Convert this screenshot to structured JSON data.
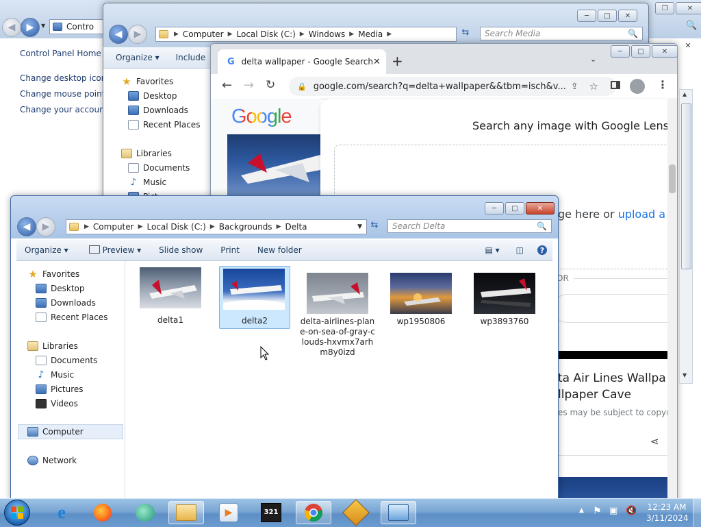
{
  "control_panel": {
    "address": "Contro",
    "home": "Control Panel Home",
    "links": [
      "Change desktop icons",
      "Change mouse pointer",
      "Change your account p"
    ]
  },
  "media_window": {
    "breadcrumb": [
      "Computer",
      "Local Disk (C:)",
      "Windows",
      "Media"
    ],
    "search_placeholder": "Search Media",
    "toolbar": [
      "Organize",
      "Include"
    ],
    "nav": {
      "favorites": "Favorites",
      "desktop": "Desktop",
      "downloads": "Downloads",
      "recent": "Recent Places",
      "libraries": "Libraries",
      "documents": "Documents",
      "music": "Music",
      "pictures": "Pict"
    }
  },
  "chrome": {
    "tab_title": "delta wallpaper - Google Search",
    "new_tab": "+",
    "url": "google.com/search?q=delta+wallpaper&&tbm=isch&v...",
    "logo": "Google",
    "lens_title": "Search any image with Google Lens",
    "drop_text": "ge here or",
    "upload_link": "upload a fi",
    "or_text": "OR",
    "result_title": [
      "ta Air Lines Wallpa",
      "llpaper Cave"
    ],
    "result_note": "es may be subject to copyrig"
  },
  "delta_window": {
    "breadcrumb": [
      "Computer",
      "Local Disk (C:)",
      "Backgrounds",
      "Delta"
    ],
    "search_placeholder": "Search Delta",
    "toolbar": {
      "organize": "Organize",
      "preview": "Preview",
      "slideshow": "Slide show",
      "print": "Print",
      "new_folder": "New folder"
    },
    "nav": {
      "favorites": "Favorites",
      "desktop": "Desktop",
      "downloads": "Downloads",
      "recent": "Recent Places",
      "libraries": "Libraries",
      "documents": "Documents",
      "music": "Music",
      "pictures": "Pictures",
      "videos": "Videos",
      "computer": "Computer",
      "network": "Network"
    },
    "files": [
      {
        "name": "delta1",
        "selected": false
      },
      {
        "name": "delta2",
        "selected": true
      },
      {
        "name": "delta-airlines-plane-on-sea-of-gray-clouds-hxvmx7arhm8y0izd",
        "selected": false
      },
      {
        "name": "wp1950806",
        "selected": false
      },
      {
        "name": "wp3893760",
        "selected": false
      }
    ]
  },
  "taskbar": {
    "time": "12:23 AM",
    "date": "3/11/2024",
    "apps": [
      "start-orb",
      "internet-explorer",
      "firefox",
      "chat-app",
      "windows-explorer",
      "media-player",
      "media-player-classic",
      "chrome",
      "winamp",
      "control-panel"
    ]
  }
}
